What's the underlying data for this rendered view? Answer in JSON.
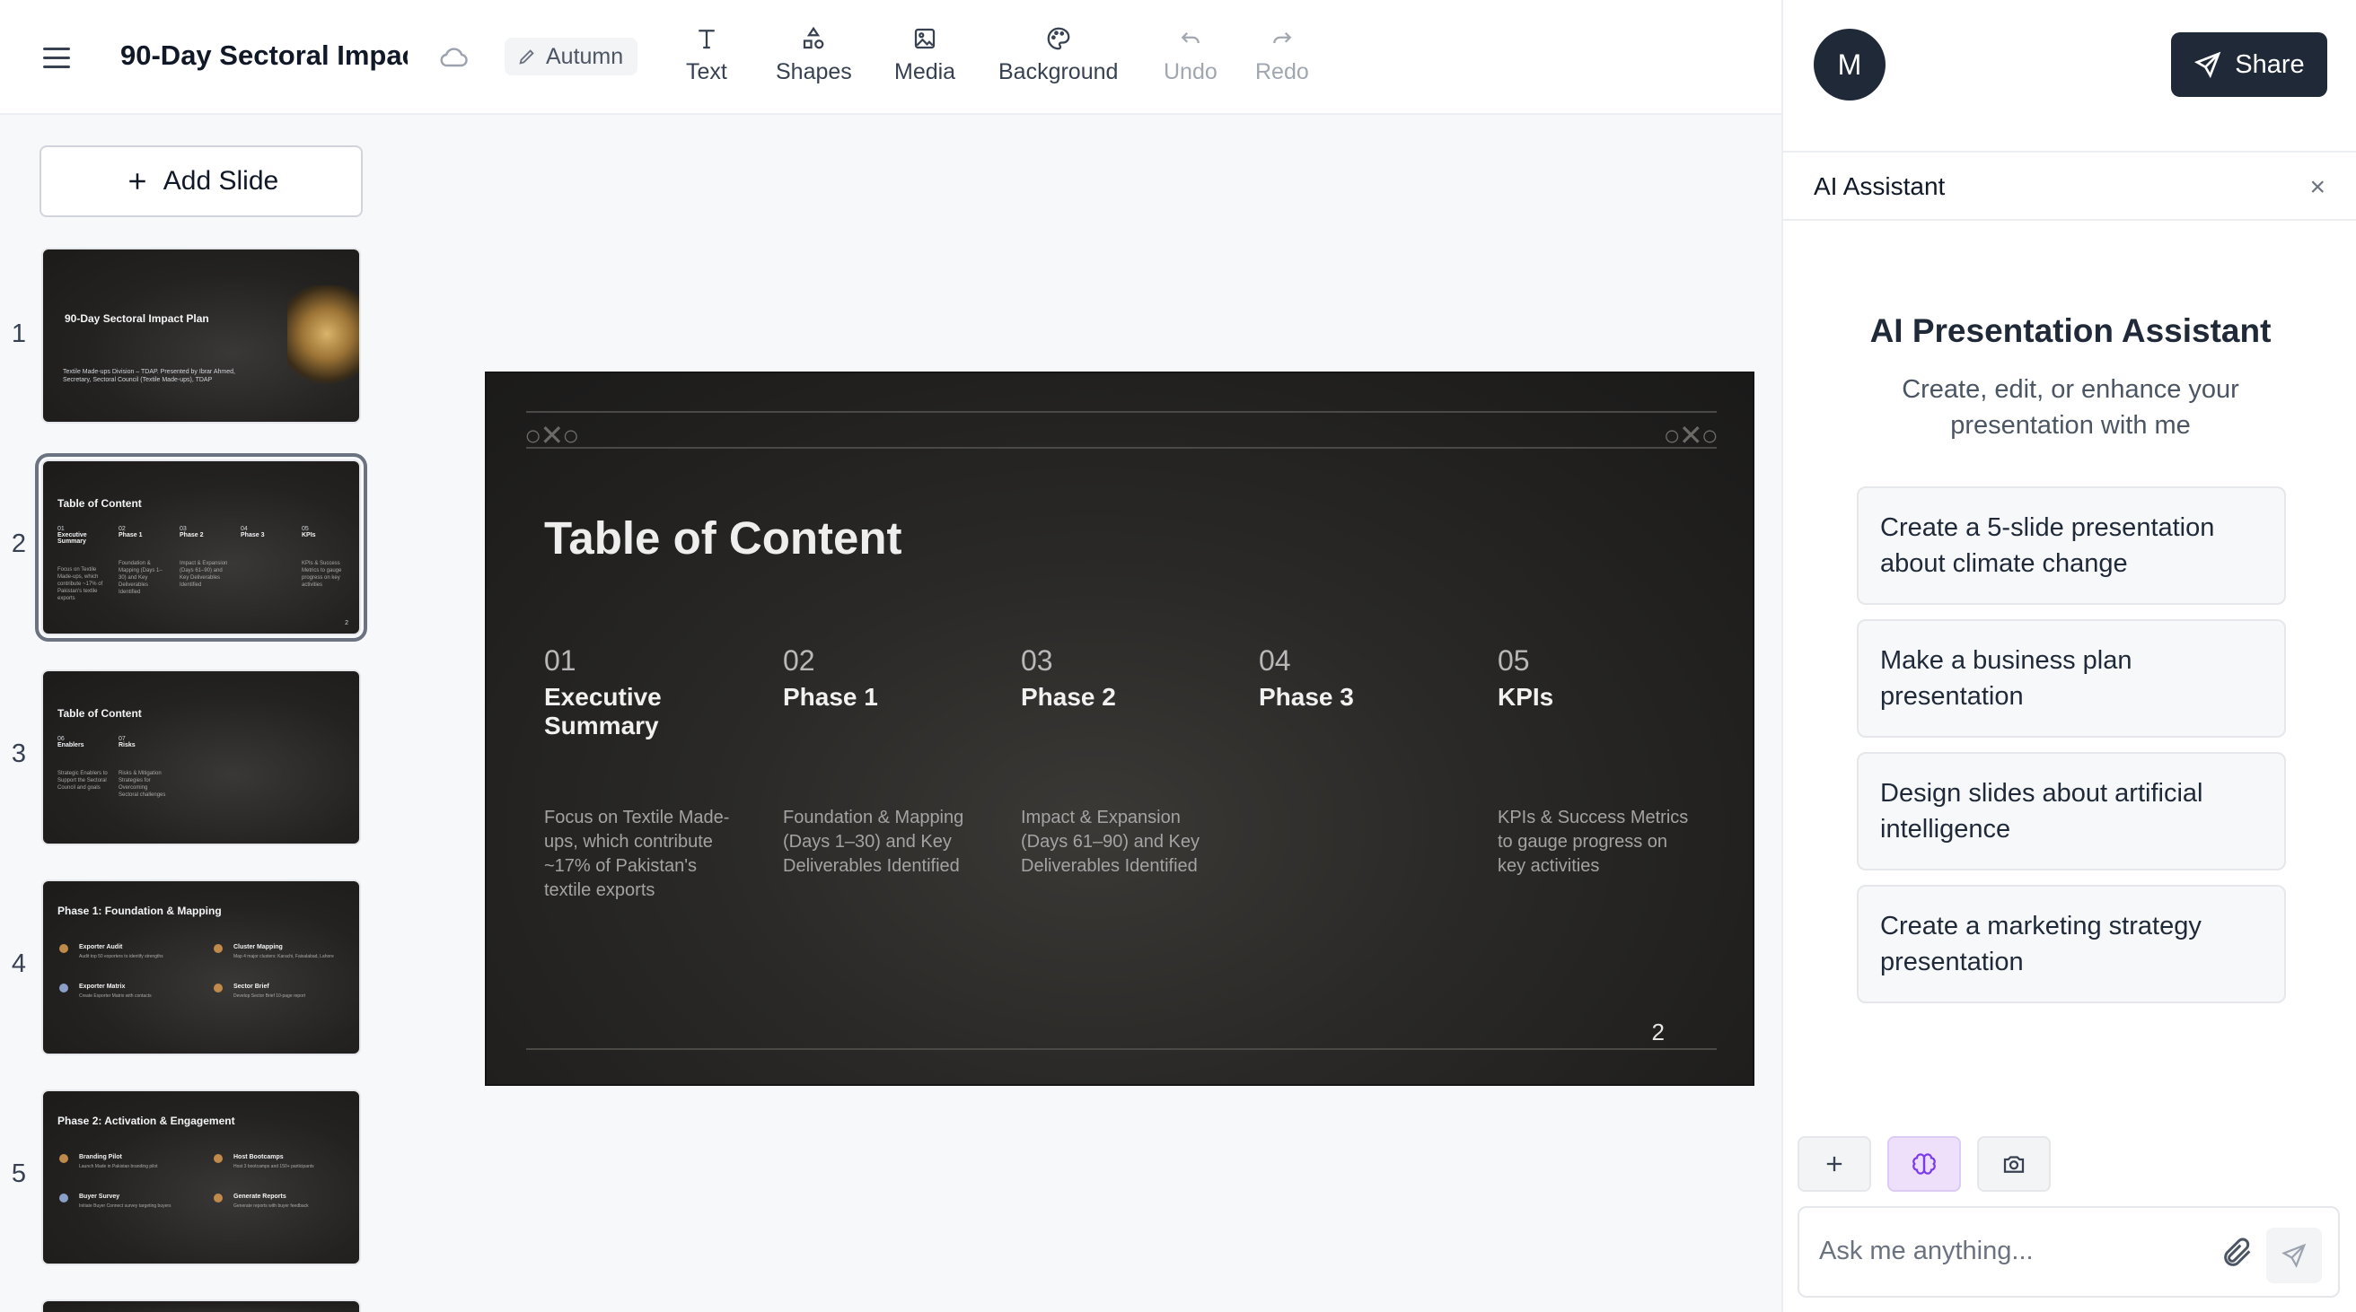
{
  "header": {
    "doc_title": "90-Day Sectoral Impac",
    "theme_label": "Autumn",
    "tools": [
      {
        "label": "Text",
        "icon": "text-icon",
        "enabled": true
      },
      {
        "label": "Shapes",
        "icon": "shapes-icon",
        "enabled": true
      },
      {
        "label": "Media",
        "icon": "image-icon",
        "enabled": true
      },
      {
        "label": "Background",
        "icon": "palette-icon",
        "enabled": true
      },
      {
        "label": "Undo",
        "icon": "undo-icon",
        "enabled": false
      },
      {
        "label": "Redo",
        "icon": "redo-icon",
        "enabled": false
      }
    ],
    "avatar_initial": "M",
    "share_label": "Share"
  },
  "sidebar": {
    "add_slide_label": "Add Slide",
    "slides": [
      {
        "number": "1",
        "title": "90-Day Sectoral Impact Plan",
        "subtitle": "Textile Made-ups Division – TDAP. Presented by Ibrar Ahmed, Secretary, Sectoral Council (Textile Made-ups), TDAP"
      },
      {
        "number": "2",
        "title": "Table of Content",
        "selected": true
      },
      {
        "number": "3",
        "title": "Table of Content",
        "cols": [
          {
            "num": "06",
            "head": "Enablers",
            "desc": "Strategic Enablers to Support the Sectoral Council and goals"
          },
          {
            "num": "07",
            "head": "Risks",
            "desc": "Risks & Mitigation Strategies for Overcoming Sectoral challenges"
          }
        ]
      },
      {
        "number": "4",
        "title": "Phase 1: Foundation & Mapping",
        "items": [
          {
            "head": "Exporter Audit",
            "desc": "Audit top 50 exporters to identify strengths"
          },
          {
            "head": "Cluster Mapping",
            "desc": "Map 4 major clusters: Karachi, Faisalabad, Lahore"
          },
          {
            "head": "Exporter Matrix",
            "desc": "Create Exporter Matrix with contacts"
          },
          {
            "head": "Sector Brief",
            "desc": "Develop Sector Brief 10-page report"
          }
        ]
      },
      {
        "number": "5",
        "title": "Phase 2: Activation & Engagement",
        "items": [
          {
            "head": "Branding Pilot",
            "desc": "Launch Made in Pakistan branding pilot"
          },
          {
            "head": "Host Bootcamps",
            "desc": "Host 3 bootcamps and 150+ participants"
          },
          {
            "head": "Buyer Survey",
            "desc": "Initiate Buyer Connect survey targeting buyers"
          },
          {
            "head": "Generate Reports",
            "desc": "Generate reports with buyer feedback"
          }
        ]
      }
    ]
  },
  "slide": {
    "title": "Table of Content",
    "page": "2",
    "columns": [
      {
        "num": "01",
        "head": "Executive Summary",
        "desc": "Focus on Textile Made-ups, which contribute ~17% of Pakistan's textile exports"
      },
      {
        "num": "02",
        "head": "Phase 1",
        "desc": "Foundation & Mapping (Days 1–30) and Key Deliverables Identified"
      },
      {
        "num": "03",
        "head": "Phase 2",
        "desc": "Impact & Expansion (Days 61–90) and Key Deliverables Identified"
      },
      {
        "num": "04",
        "head": "Phase 3",
        "desc": ""
      },
      {
        "num": "05",
        "head": "KPIs",
        "desc": "KPIs & Success Metrics to gauge progress on key activities"
      }
    ]
  },
  "assistant": {
    "panel_title": "AI Assistant",
    "close_label": "×",
    "heading": "AI Presentation Assistant",
    "subheading": "Create, edit, or enhance your presentation with me",
    "suggestions": [
      "Create a 5-slide presentation about climate change",
      "Make a business plan presentation",
      "Design slides about artificial intelligence",
      "Create a marketing strategy presentation"
    ],
    "input_placeholder": "Ask me anything..."
  },
  "colors": {
    "dark": "#1f2937",
    "slide_bg": "#2a2927",
    "accent_purple": "#eee0fb"
  }
}
